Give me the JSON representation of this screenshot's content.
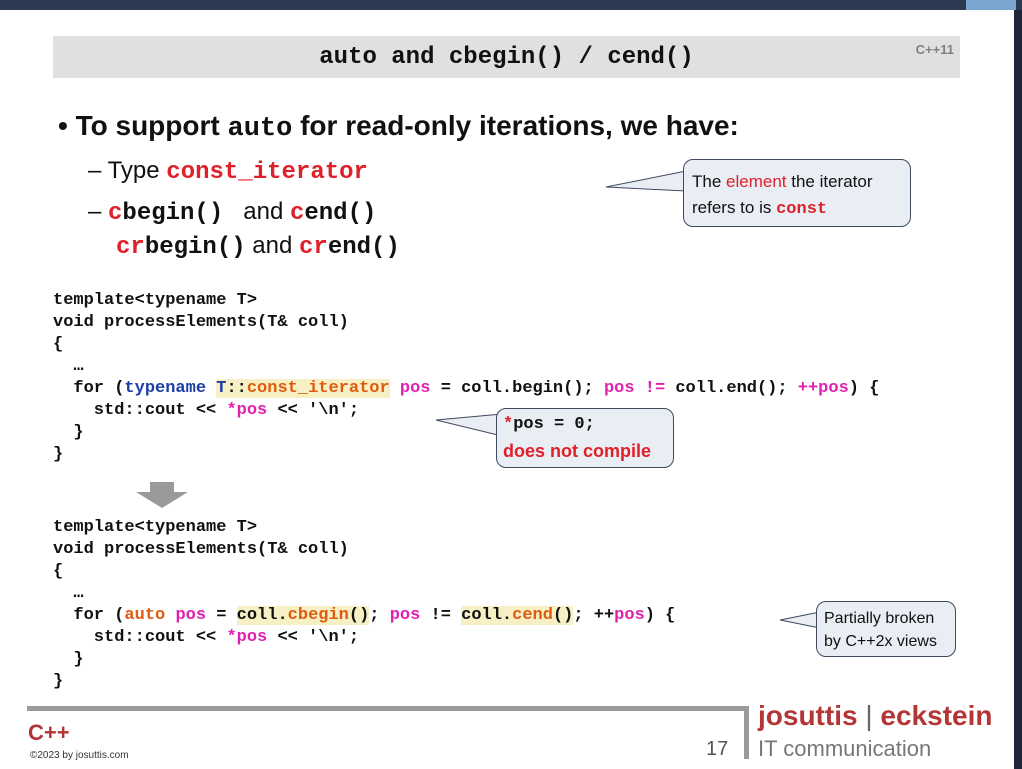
{
  "title": {
    "part1": "auto",
    "part2": " and ",
    "part3": "cbegin() / cend()",
    "badge": "C++11"
  },
  "bullet": {
    "marker": "•",
    "text1": "To support ",
    "code": "auto",
    "text2": " for read-only iterations, we have:"
  },
  "sub1": {
    "dash": "– ",
    "text": "Type ",
    "code": "const_iterator"
  },
  "sub2": {
    "dash": "– ",
    "c1": "c",
    "begin": "begin()",
    "and1": "   and ",
    "c2": "c",
    "end": "end()"
  },
  "sub3": {
    "cr1": "cr",
    "rbegin": "begin()",
    "and2": " and ",
    "cr2": "cr",
    "rend": "end()"
  },
  "callout1": {
    "t1": "The ",
    "element": "element",
    "t2": " the iterator",
    "t3": "refers to is ",
    "const": "const"
  },
  "code1": {
    "l1": "template<typename T>",
    "l2": "void processElements(T& coll)",
    "l3": "{",
    "l4": "  …",
    "l5_for": "  for (",
    "l5_typename": "typename",
    "l5_sp": " ",
    "l5_T": "T",
    "l5_colons": "::",
    "l5_const_iter": "const_iterator",
    "l5_sp2": " ",
    "l5_pos": "pos",
    "l5_eq": " = coll.begin(); ",
    "l5_pos2": "pos",
    "l5_ne": " != ",
    "l5_rest1": "coll.end(); ",
    "l5_inc": "++pos",
    "l5_rest2": ") {",
    "l6_a": "    std::cout << ",
    "l6_star": "*pos",
    "l6_b": " << '\\n';",
    "l7": "  }",
    "l8": "}"
  },
  "callout2": {
    "star": "*",
    "code": "pos = 0;",
    "msg": "does not compile"
  },
  "code2": {
    "l1": "template<typename T>",
    "l2": "void processElements(T& coll)",
    "l3": "{",
    "l4": "  …",
    "l5_for": "  for (",
    "l5_auto": "auto",
    "l5_sp": " ",
    "l5_pos": "pos",
    "l5_eq": " = ",
    "l5_coll1": "coll.",
    "l5_cbegin": "cbegin",
    "l5_p1": "()",
    "l5_semi": "; ",
    "l5_pos2": "pos",
    "l5_ne": " != ",
    "l5_coll2": "coll.",
    "l5_cend": "cend",
    "l5_p2": "()",
    "l5_semi2": "; ++",
    "l5_pos3": "pos",
    "l5_rest": ") {",
    "l6_a": "    std::cout << ",
    "l6_star": "*pos",
    "l6_b": " << '\\n';",
    "l7": "  }",
    "l8": "}"
  },
  "callout3": {
    "line1": "Partially broken",
    "line2": "by C++2x views"
  },
  "footer": {
    "cpp": "C++",
    "copyright": "©2023 by josuttis.com",
    "page": "17",
    "brand_a": "josuttis",
    "brand_sep": " | ",
    "brand_b": "eckstein",
    "brand_sub": "IT communication"
  },
  "colors": {
    "accent_red": "#e0202a",
    "keyword_blue": "#1c3ea6",
    "magenta": "#e020b0",
    "orange": "#e05a10",
    "brand": "#b33535"
  }
}
